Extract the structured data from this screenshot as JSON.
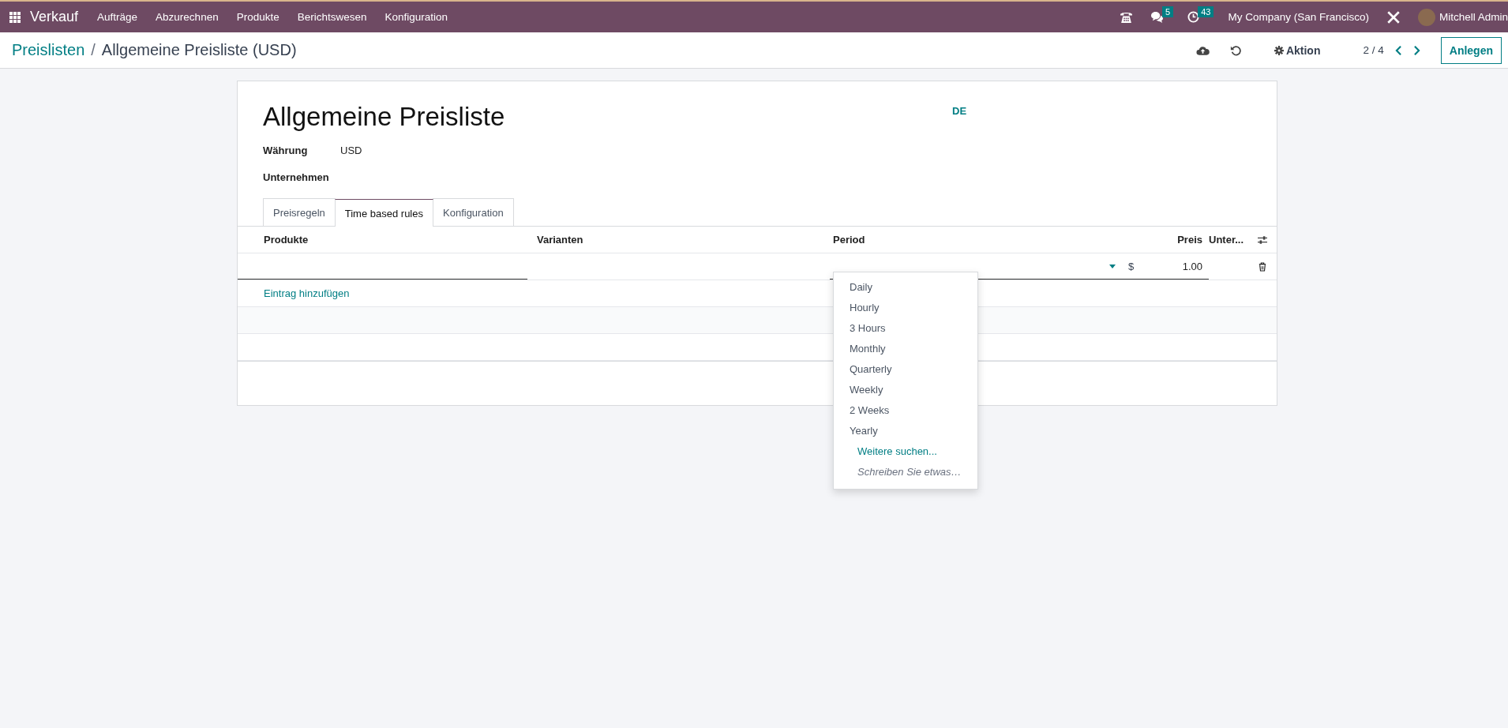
{
  "navbar": {
    "app_name": "Verkauf",
    "menu": [
      "Aufträge",
      "Abzurechnen",
      "Produkte",
      "Berichtswesen",
      "Konfiguration"
    ],
    "messages_badge": "5",
    "activities_badge": "43",
    "company": "My Company (San Francisco)",
    "user": "Mitchell Admin"
  },
  "breadcrumb": {
    "parent": "Preislisten",
    "separator": "/",
    "current": "Allgemeine Preisliste (USD)"
  },
  "control_panel": {
    "action": "Aktion",
    "pager": "2 / 4",
    "create_button": "Anlegen"
  },
  "form": {
    "title": "Allgemeine Preisliste",
    "language": "DE",
    "fields": [
      {
        "label": "Währung",
        "value": "USD"
      },
      {
        "label": "Unternehmen"
      }
    ]
  },
  "tabs": [
    {
      "label": "Preisregeln",
      "selected": false
    },
    {
      "label": "Time based rules",
      "selected": true
    },
    {
      "label": "Konfiguration",
      "selected": false
    }
  ],
  "table": {
    "columns": [
      "Produkte",
      "Varianten",
      "Period",
      "Preis",
      "Unter..."
    ],
    "rows": [
      {
        "currency": "$",
        "price": "1.00"
      }
    ],
    "add_line": "Eintrag hinzufügen"
  },
  "dropdown": {
    "options": [
      "Daily",
      "Hourly",
      "3 Hours",
      "Monthly",
      "Quarterly",
      "Weekly",
      "2 Weeks",
      "Yearly"
    ],
    "search_more": "Weitere suchen...",
    "create_hint": "Schreiben Sie etwas…"
  }
}
